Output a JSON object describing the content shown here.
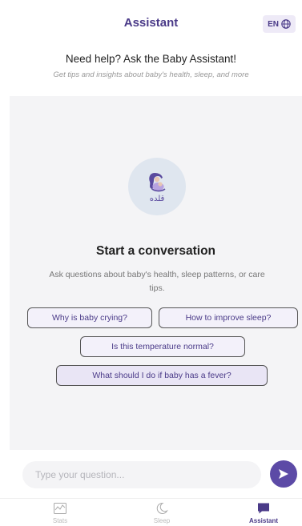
{
  "header": {
    "title": "Assistant",
    "lang_label": "EN"
  },
  "intro": {
    "heading": "Need help? Ask the Baby Assistant!",
    "subheading": "Get tips and insights about baby's health, sleep, and more"
  },
  "empty_state": {
    "logo_text": "قلده",
    "title": "Start a conversation",
    "subtitle": "Ask questions about baby's health, sleep patterns, or care tips."
  },
  "suggestions": [
    "Why is baby crying?",
    "How to improve sleep?",
    "Is this temperature normal?",
    "What should I do if baby has a fever?"
  ],
  "composer": {
    "placeholder": "Type your question...",
    "value": ""
  },
  "nav": {
    "items": [
      {
        "label": "Stats",
        "icon": "chart-icon"
      },
      {
        "label": "Sleep",
        "icon": "moon-icon"
      },
      {
        "label": "Assistant",
        "icon": "chat-icon",
        "active": true
      }
    ]
  },
  "colors": {
    "accent": "#5c4aa6",
    "title": "#4a3a88"
  }
}
